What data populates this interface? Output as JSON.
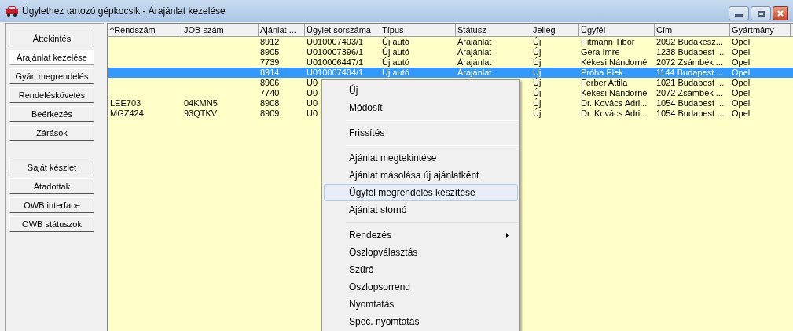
{
  "window": {
    "title": "Ügylethez tartozó gépkocsik - Árajánlat kezelése"
  },
  "sidebar": {
    "groups": [
      [
        {
          "label": "Áttekintés",
          "selected": false
        },
        {
          "label": "Árajánlat kezelése",
          "selected": true
        },
        {
          "label": "Gyári megrendelés",
          "selected": false
        },
        {
          "label": "Rendeléskövetés",
          "selected": false
        },
        {
          "label": "Beérkezés",
          "selected": false
        },
        {
          "label": "Zárások",
          "selected": false
        }
      ],
      [
        {
          "label": "Saját készlet",
          "selected": false
        },
        {
          "label": "Átadottak",
          "selected": false
        },
        {
          "label": "OWB interface",
          "selected": false
        },
        {
          "label": "OWB státuszok",
          "selected": false
        }
      ]
    ]
  },
  "table": {
    "columns": [
      "^Rendszám",
      "JOB szám",
      "Ajánlat ...",
      "Ügylet sorszáma",
      "Típus",
      "Státusz",
      "Jelleg",
      "Ügyfél",
      "Cím",
      "Gyártmány"
    ],
    "rows": [
      {
        "selected": false,
        "cells": [
          null,
          null,
          "8912",
          "U010007403/1",
          "Új autó",
          "Árajánlat",
          "Új",
          "Hitmann Tibor",
          "2092 Budakesz...",
          "Opel"
        ]
      },
      {
        "selected": false,
        "cells": [
          null,
          null,
          "8905",
          "U010007396/1",
          "Új autó",
          "Árajánlat",
          "Új",
          "Gera Imre",
          "1238 Budapest ...",
          "Opel"
        ]
      },
      {
        "selected": false,
        "cells": [
          null,
          null,
          "7739",
          "U010006447/1",
          "Új autó",
          "Árajánlat",
          "Új",
          "Kékesi Nándorné",
          "2072 Zsámbék ...",
          "Opel"
        ]
      },
      {
        "selected": true,
        "cells": [
          null,
          null,
          "8914",
          "U010007404/1",
          "Új autó",
          "Árajánlat",
          "Új",
          "Próba Elek",
          "1144 Budapest ...",
          "Opel"
        ]
      },
      {
        "selected": false,
        "cells": [
          null,
          null,
          "8906",
          "U0",
          null,
          null,
          "Új",
          "Ferber Attila",
          "1021 Budapest ...",
          "Opel"
        ]
      },
      {
        "selected": false,
        "cells": [
          null,
          null,
          "7740",
          "U0",
          null,
          null,
          "Új",
          "Kékesi Nándorné",
          "2072 Zsámbék ...",
          "Opel"
        ]
      },
      {
        "selected": false,
        "cells": [
          "LEE703",
          "04KMN5",
          "8908",
          "U0",
          null,
          null,
          "Új",
          "Dr. Kovács Adri...",
          "1054 Budapest ...",
          "Opel"
        ]
      },
      {
        "selected": false,
        "cells": [
          "MGZ424",
          "93QTKV",
          "8909",
          "U0",
          null,
          null,
          "Új",
          "Dr. Kovács Adri...",
          "1054 Budapest ...",
          "Opel"
        ]
      }
    ]
  },
  "context_menu": {
    "items": [
      {
        "kind": "item",
        "label": "Új",
        "selected": false
      },
      {
        "kind": "item",
        "label": "Módosít",
        "selected": false
      },
      {
        "kind": "separator"
      },
      {
        "kind": "item",
        "label": "Frissítés",
        "selected": false
      },
      {
        "kind": "separator"
      },
      {
        "kind": "item",
        "label": "Ajánlat megtekintése",
        "selected": false
      },
      {
        "kind": "item",
        "label": "Ajánlat másolása új ajánlatként",
        "selected": false
      },
      {
        "kind": "item",
        "label": "Ügyfél megrendelés készítése",
        "selected": true
      },
      {
        "kind": "item",
        "label": "Ajánlat stornó",
        "selected": false
      },
      {
        "kind": "separator"
      },
      {
        "kind": "submenu",
        "label": "Rendezés",
        "selected": false
      },
      {
        "kind": "item",
        "label": "Oszlopválasztás",
        "selected": false
      },
      {
        "kind": "item",
        "label": "Szűrő",
        "selected": false
      },
      {
        "kind": "item",
        "label": "Oszlopsorrend",
        "selected": false
      },
      {
        "kind": "item",
        "label": "Nyomtatás",
        "selected": false
      },
      {
        "kind": "item",
        "label": "Spec. nyomtatás",
        "selected": false
      }
    ]
  }
}
